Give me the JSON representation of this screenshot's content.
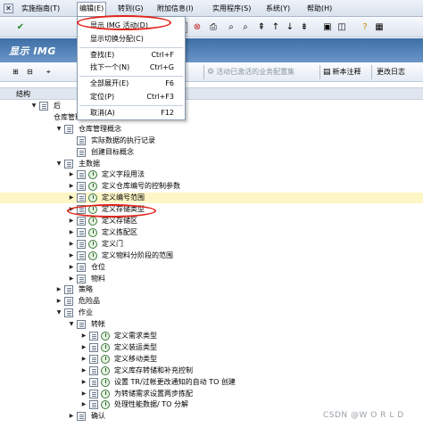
{
  "menubar": {
    "items": [
      "实施指南(T)",
      "编辑(E)",
      "转到(G)",
      "附加信息(I)",
      "实用程序(S)",
      "系统(Y)",
      "帮助(H)"
    ]
  },
  "titlebar": {
    "title": "显示 IMG"
  },
  "apptoolbar": {
    "btn_sets": "活动已激活的业务配置集",
    "btn_release": "新本注释",
    "btn_changelog": "更改日志"
  },
  "structure": {
    "header": "结构"
  },
  "edit_menu": {
    "items": [
      {
        "label": "显示 IMG 活动(D)",
        "shortcut": ""
      },
      {
        "label": "显示切换分配(C)",
        "shortcut": ""
      },
      {
        "label": "查找(E)",
        "shortcut": "Ctrl+F"
      },
      {
        "label": "找下一个(N)",
        "shortcut": "Ctrl+G"
      },
      {
        "label": "全部展开(E)",
        "shortcut": "F6"
      },
      {
        "label": "定位(P)",
        "shortcut": "Ctrl+F3"
      },
      {
        "label": "取消(A)",
        "shortcut": "F12"
      }
    ]
  },
  "tree": [
    {
      "label": "后",
      "level": 0,
      "toggle": "▼",
      "icon": "doc"
    },
    {
      "label": "仓库管理",
      "level": 1,
      "toggle": "",
      "icon": "none"
    },
    {
      "label": "仓库管理概念",
      "level": 2,
      "toggle": "▼",
      "icon": "doc"
    },
    {
      "label": "实际数据的执行记录",
      "level": 3,
      "toggle": "",
      "icon": "doc"
    },
    {
      "label": "创建目标概念",
      "level": 3,
      "toggle": "",
      "icon": "doc"
    },
    {
      "label": "主数据",
      "level": 2,
      "toggle": "▼",
      "icon": "doc"
    },
    {
      "label": "定义字段用法",
      "level": 3,
      "toggle": "▶",
      "icon": "clock"
    },
    {
      "label": "定义仓库编号的控制参数",
      "level": 3,
      "toggle": "▶",
      "icon": "clock"
    },
    {
      "label": "定义编号范围",
      "level": 3,
      "toggle": "▶",
      "icon": "clock"
    },
    {
      "label": "定义存储类型",
      "level": 3,
      "toggle": "▶",
      "icon": "clock"
    },
    {
      "label": "定义存储区",
      "level": 3,
      "toggle": "▶",
      "icon": "clock"
    },
    {
      "label": "定义拣配区",
      "level": 3,
      "toggle": "▶",
      "icon": "clock"
    },
    {
      "label": "定义门",
      "level": 3,
      "toggle": "▶",
      "icon": "clock"
    },
    {
      "label": "定义物料分阶段的范围",
      "level": 3,
      "toggle": "▶",
      "icon": "clock"
    },
    {
      "label": "仓位",
      "level": 3,
      "toggle": "▶",
      "icon": "doc"
    },
    {
      "label": "物料",
      "level": 3,
      "toggle": "▶",
      "icon": "doc"
    },
    {
      "label": "策略",
      "level": 2,
      "toggle": "▶",
      "icon": "doc"
    },
    {
      "label": "危险品",
      "level": 2,
      "toggle": "▶",
      "icon": "doc"
    },
    {
      "label": "作业",
      "level": 2,
      "toggle": "▼",
      "icon": "doc"
    },
    {
      "label": "转帐",
      "level": 3,
      "toggle": "▼",
      "icon": "doc"
    },
    {
      "label": "定义需求类型",
      "level": 4,
      "toggle": "▶",
      "icon": "clock"
    },
    {
      "label": "定义装运类型",
      "level": 4,
      "toggle": "▶",
      "icon": "clock"
    },
    {
      "label": "定义移动类型",
      "level": 4,
      "toggle": "▶",
      "icon": "clock"
    },
    {
      "label": "定义库存转储和补充控制",
      "level": 4,
      "toggle": "▶",
      "icon": "clock"
    },
    {
      "label": "设置 TR/过帐更改通知的自动 TO 创建",
      "level": 4,
      "toggle": "▶",
      "icon": "clock"
    },
    {
      "label": "为转储需求设置两步拣配",
      "level": 4,
      "toggle": "▶",
      "icon": "clock"
    },
    {
      "label": "处理性能数据/ TO 分解",
      "level": 4,
      "toggle": "▶",
      "icon": "clock"
    },
    {
      "label": "确认",
      "level": 3,
      "toggle": "▶",
      "icon": "doc"
    }
  ],
  "watermark": "CSDN @W O R L D"
}
